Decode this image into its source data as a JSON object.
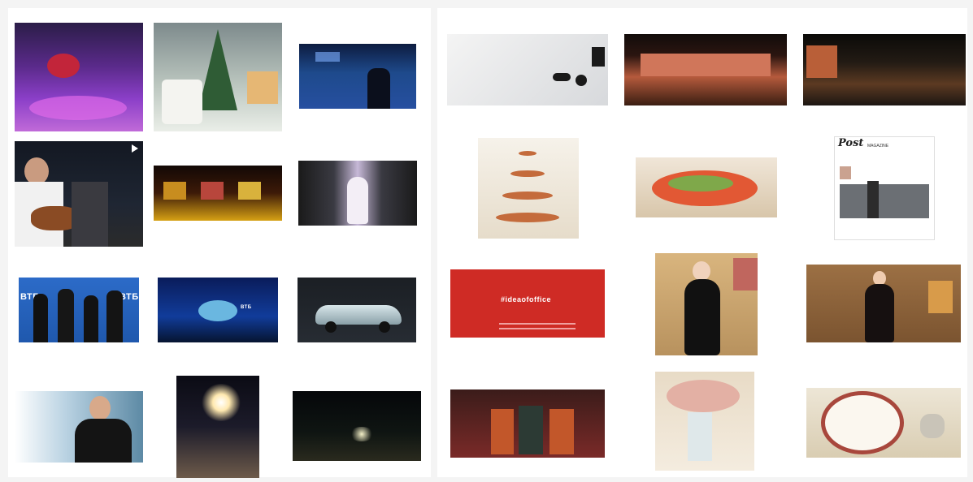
{
  "gallery": {
    "tile_labels": {
      "bank_logo": "ВТБ",
      "red_card_hashtag": "#ideaofoffice",
      "magazine_title": "Post",
      "magazine_subtitle": "MAGAZINE"
    }
  }
}
